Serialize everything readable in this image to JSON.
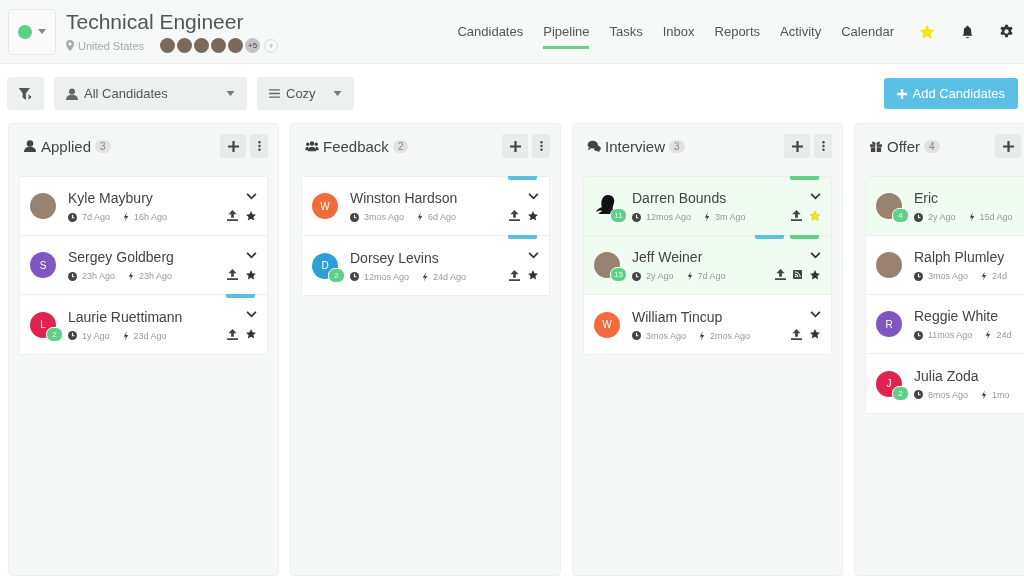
{
  "header": {
    "title": "Technical Engineer",
    "location": "United States",
    "team": {
      "avatars": [
        {
          "kind": "photo"
        },
        {
          "kind": "photo"
        },
        {
          "kind": "photo"
        },
        {
          "kind": "photo"
        },
        {
          "kind": "photo"
        }
      ],
      "more": "+5",
      "add": "+"
    }
  },
  "nav": [
    {
      "label": "Candidates",
      "selected": false
    },
    {
      "label": "Pipeline",
      "selected": true
    },
    {
      "label": "Tasks",
      "selected": false
    },
    {
      "label": "Inbox",
      "selected": false
    },
    {
      "label": "Reports",
      "selected": false
    },
    {
      "label": "Activity",
      "selected": false
    },
    {
      "label": "Calendar",
      "selected": false
    }
  ],
  "toolbar": {
    "filter": "All Candidates",
    "view": "Cozy",
    "add_button": "Add Candidates"
  },
  "columns": [
    {
      "kind": "applied",
      "title": "Applied",
      "count": "3",
      "cards": [
        {
          "name": "Kyle Maybury",
          "avatar": {
            "kind": "photo"
          },
          "created": "7d Ago",
          "activity": "16h Ago",
          "highlighted": false,
          "actions": {
            "starred": false
          }
        },
        {
          "name": "Sergey Goldberg",
          "avatar": {
            "kind": "initial",
            "initial": "S",
            "color": "#7e57c2"
          },
          "created": "23h Ago",
          "activity": "23h Ago",
          "highlighted": false,
          "actions": {
            "starred": false
          }
        },
        {
          "name": "Laurie Ruettimann",
          "avatar": {
            "kind": "initial",
            "initial": "L",
            "color": "#e0234f"
          },
          "badge": "2",
          "created": "1y Ago",
          "activity": "23d Ago",
          "highlighted": false,
          "tags": [
            {
              "color": "#5bc0de"
            }
          ],
          "actions": {
            "starred": false
          }
        }
      ]
    },
    {
      "kind": "feedback",
      "title": "Feedback",
      "count": "2",
      "cards": [
        {
          "name": "Winston Hardson",
          "avatar": {
            "kind": "initial",
            "initial": "W",
            "color": "#f26b3a"
          },
          "created": "3mos Ago",
          "activity": "6d Ago",
          "highlighted": false,
          "tags": [
            {
              "color": "#5bc0de"
            }
          ],
          "actions": {
            "starred": false
          }
        },
        {
          "name": "Dorsey Levins",
          "avatar": {
            "kind": "initial",
            "initial": "D",
            "color": "#2e9fd6"
          },
          "badge": "2",
          "created": "12mos Ago",
          "activity": "24d Ago",
          "highlighted": false,
          "tags": [
            {
              "color": "#5bc0de"
            }
          ],
          "actions": {
            "starred": false
          }
        }
      ]
    },
    {
      "kind": "interview",
      "title": "Interview",
      "count": "3",
      "cards": [
        {
          "name": "Darren Bounds",
          "avatar": {
            "kind": "silhouette"
          },
          "badge": "11",
          "created": "12mos Ago",
          "activity": "3m Ago",
          "highlighted": true,
          "tags": [
            {
              "color": "#5fd08a"
            }
          ],
          "actions": {
            "starred": true
          }
        },
        {
          "name": "Jeff Weiner",
          "avatar": {
            "kind": "photo"
          },
          "badge": "15",
          "created": "2y Ago",
          "activity": "7d Ago",
          "highlighted": true,
          "tags": [
            {
              "color": "#5bc0de"
            },
            {
              "color": "#5fd08a"
            }
          ],
          "actions": {
            "starred": false,
            "feed": true
          }
        },
        {
          "name": "William Tincup",
          "avatar": {
            "kind": "initial",
            "initial": "W",
            "color": "#f26b3a"
          },
          "created": "3mos Ago",
          "activity": "2mos Ago",
          "highlighted": false,
          "actions": {
            "starred": false
          }
        }
      ]
    },
    {
      "kind": "offer",
      "title": "Offer",
      "count": "4",
      "cards": [
        {
          "name": "Eric",
          "avatar": {
            "kind": "photo"
          },
          "badge": "4",
          "created": "2y Ago",
          "activity": "15d Ago",
          "highlighted": true
        },
        {
          "name": "Ralph Plumley",
          "avatar": {
            "kind": "photo"
          },
          "created": "3mos Ago",
          "activity": "24d",
          "highlighted": false
        },
        {
          "name": "Reggie White",
          "avatar": {
            "kind": "initial",
            "initial": "R",
            "color": "#7e57c2"
          },
          "created": "11mos Ago",
          "activity": "24d",
          "highlighted": false
        },
        {
          "name": "Julia Zoda",
          "avatar": {
            "kind": "initial",
            "initial": "J",
            "color": "#e0234f"
          },
          "badge": "2",
          "created": "8mos Ago",
          "activity": "1mo",
          "highlighted": false
        }
      ]
    }
  ]
}
